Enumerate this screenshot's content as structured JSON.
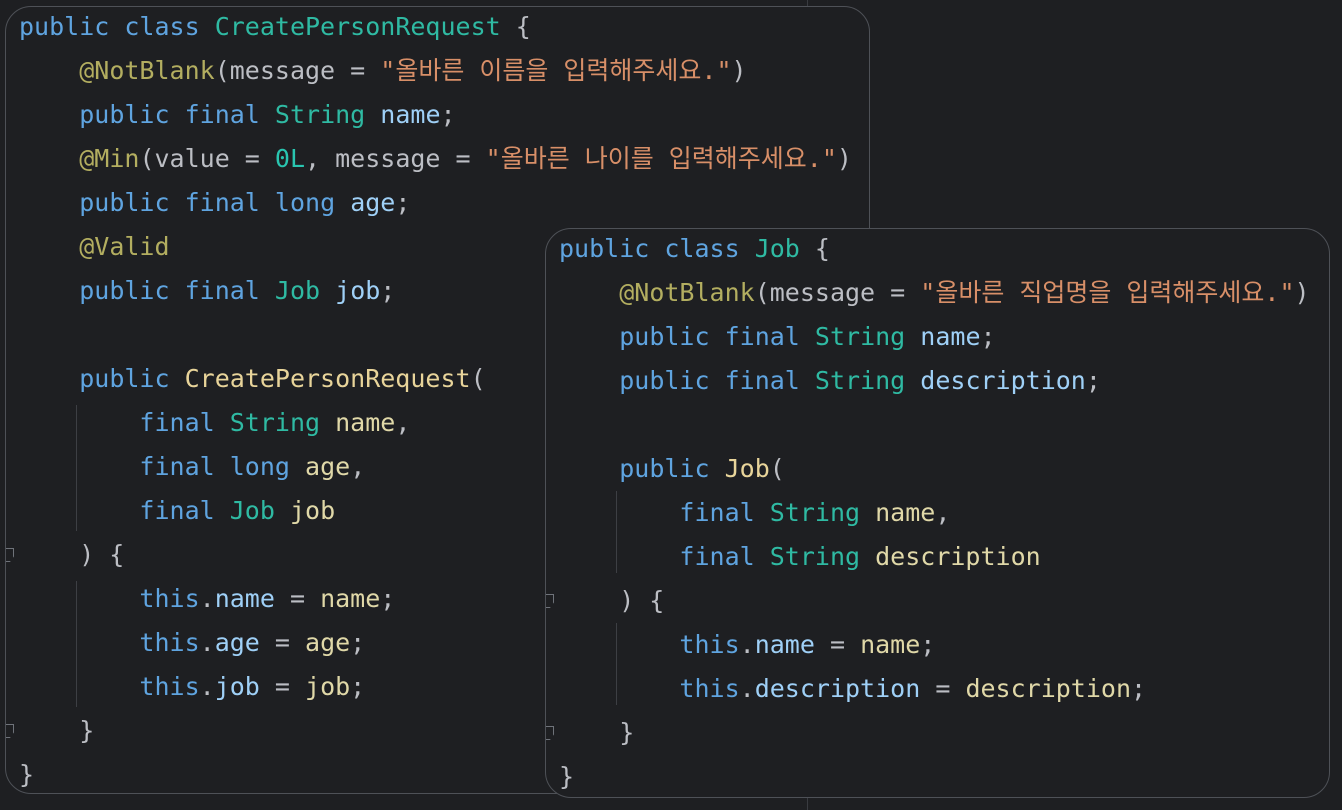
{
  "colors": {
    "background": "#1e1f22",
    "keyword": "#5fa4e0",
    "type": "#2fbaa3",
    "annotation": "#b3ae60",
    "field": "#9fd0f7",
    "function": "#e8d49a",
    "string": "#d88f68",
    "number": "#29c5b0",
    "parameter": "#e0d8a8",
    "plain": "#bcbec4"
  },
  "icons": {
    "fold_marker": "fold-marker-icon"
  },
  "left_snippet": {
    "lines": [
      [
        [
          "kw",
          "public"
        ],
        [
          "pl",
          " "
        ],
        [
          "kw",
          "class"
        ],
        [
          "pl",
          " "
        ],
        [
          "ty",
          "CreatePersonRequest"
        ],
        [
          "pl",
          " {"
        ]
      ],
      [
        [
          "pl",
          "    "
        ],
        [
          "ann",
          "@NotBlank"
        ],
        [
          "pl",
          "(message = "
        ],
        [
          "str",
          "\"올바른 이름을 입력해주세요.\""
        ],
        [
          "pl",
          ")"
        ]
      ],
      [
        [
          "pl",
          "    "
        ],
        [
          "kw",
          "public"
        ],
        [
          "pl",
          " "
        ],
        [
          "kw",
          "final"
        ],
        [
          "pl",
          " "
        ],
        [
          "ty",
          "String"
        ],
        [
          "pl",
          " "
        ],
        [
          "fld",
          "name"
        ],
        [
          "pl",
          ";"
        ]
      ],
      [
        [
          "pl",
          "    "
        ],
        [
          "ann",
          "@Min"
        ],
        [
          "pl",
          "(value = "
        ],
        [
          "num",
          "0L"
        ],
        [
          "pl",
          ", message = "
        ],
        [
          "str",
          "\"올바른 나이를 입력해주세요.\""
        ],
        [
          "pl",
          ")"
        ]
      ],
      [
        [
          "pl",
          "    "
        ],
        [
          "kw",
          "public"
        ],
        [
          "pl",
          " "
        ],
        [
          "kw",
          "final"
        ],
        [
          "pl",
          " "
        ],
        [
          "kw",
          "long"
        ],
        [
          "pl",
          " "
        ],
        [
          "fld",
          "age"
        ],
        [
          "pl",
          ";"
        ]
      ],
      [
        [
          "pl",
          "    "
        ],
        [
          "ann",
          "@Valid"
        ]
      ],
      [
        [
          "pl",
          "    "
        ],
        [
          "kw",
          "public"
        ],
        [
          "pl",
          " "
        ],
        [
          "kw",
          "final"
        ],
        [
          "pl",
          " "
        ],
        [
          "ty",
          "Job"
        ],
        [
          "pl",
          " "
        ],
        [
          "fld",
          "job"
        ],
        [
          "pl",
          ";"
        ]
      ],
      [
        [
          "pl",
          ""
        ]
      ],
      [
        [
          "pl",
          "    "
        ],
        [
          "kw",
          "public"
        ],
        [
          "pl",
          " "
        ],
        [
          "fn",
          "CreatePersonRequest"
        ],
        [
          "pl",
          "("
        ]
      ],
      [
        [
          "pl",
          "        "
        ],
        [
          "kw",
          "final"
        ],
        [
          "pl",
          " "
        ],
        [
          "ty",
          "String"
        ],
        [
          "pl",
          " "
        ],
        [
          "par",
          "name"
        ],
        [
          "pl",
          ","
        ]
      ],
      [
        [
          "pl",
          "        "
        ],
        [
          "kw",
          "final"
        ],
        [
          "pl",
          " "
        ],
        [
          "kw",
          "long"
        ],
        [
          "pl",
          " "
        ],
        [
          "par",
          "age"
        ],
        [
          "pl",
          ","
        ]
      ],
      [
        [
          "pl",
          "        "
        ],
        [
          "kw",
          "final"
        ],
        [
          "pl",
          " "
        ],
        [
          "ty",
          "Job"
        ],
        [
          "pl",
          " "
        ],
        [
          "par",
          "job"
        ]
      ],
      [
        [
          "pl",
          "    ) {"
        ]
      ],
      [
        [
          "pl",
          "        "
        ],
        [
          "kw",
          "this"
        ],
        [
          "pl",
          "."
        ],
        [
          "fld",
          "name"
        ],
        [
          "pl",
          " = "
        ],
        [
          "par",
          "name"
        ],
        [
          "pl",
          ";"
        ]
      ],
      [
        [
          "pl",
          "        "
        ],
        [
          "kw",
          "this"
        ],
        [
          "pl",
          "."
        ],
        [
          "fld",
          "age"
        ],
        [
          "pl",
          " = "
        ],
        [
          "par",
          "age"
        ],
        [
          "pl",
          ";"
        ]
      ],
      [
        [
          "pl",
          "        "
        ],
        [
          "kw",
          "this"
        ],
        [
          "pl",
          "."
        ],
        [
          "fld",
          "job"
        ],
        [
          "pl",
          " = "
        ],
        [
          "par",
          "job"
        ],
        [
          "pl",
          ";"
        ]
      ],
      [
        [
          "pl",
          "    }"
        ]
      ],
      [
        [
          "pl",
          "}"
        ]
      ]
    ]
  },
  "right_snippet": {
    "lines": [
      [
        [
          "kw",
          "public"
        ],
        [
          "pl",
          " "
        ],
        [
          "kw",
          "class"
        ],
        [
          "pl",
          " "
        ],
        [
          "ty",
          "Job"
        ],
        [
          "pl",
          " {"
        ]
      ],
      [
        [
          "pl",
          "    "
        ],
        [
          "ann",
          "@NotBlank"
        ],
        [
          "pl",
          "(message = "
        ],
        [
          "str",
          "\"올바른 직업명을 입력해주세요.\""
        ],
        [
          "pl",
          ")"
        ]
      ],
      [
        [
          "pl",
          "    "
        ],
        [
          "kw",
          "public"
        ],
        [
          "pl",
          " "
        ],
        [
          "kw",
          "final"
        ],
        [
          "pl",
          " "
        ],
        [
          "ty",
          "String"
        ],
        [
          "pl",
          " "
        ],
        [
          "fld",
          "name"
        ],
        [
          "pl",
          ";"
        ]
      ],
      [
        [
          "pl",
          "    "
        ],
        [
          "kw",
          "public"
        ],
        [
          "pl",
          " "
        ],
        [
          "kw",
          "final"
        ],
        [
          "pl",
          " "
        ],
        [
          "ty",
          "String"
        ],
        [
          "pl",
          " "
        ],
        [
          "fld",
          "description"
        ],
        [
          "pl",
          ";"
        ]
      ],
      [
        [
          "pl",
          ""
        ]
      ],
      [
        [
          "pl",
          "    "
        ],
        [
          "kw",
          "public"
        ],
        [
          "pl",
          " "
        ],
        [
          "fn",
          "Job"
        ],
        [
          "pl",
          "("
        ]
      ],
      [
        [
          "pl",
          "        "
        ],
        [
          "kw",
          "final"
        ],
        [
          "pl",
          " "
        ],
        [
          "ty",
          "String"
        ],
        [
          "pl",
          " "
        ],
        [
          "par",
          "name"
        ],
        [
          "pl",
          ","
        ]
      ],
      [
        [
          "pl",
          "        "
        ],
        [
          "kw",
          "final"
        ],
        [
          "pl",
          " "
        ],
        [
          "ty",
          "String"
        ],
        [
          "pl",
          " "
        ],
        [
          "par",
          "description"
        ]
      ],
      [
        [
          "pl",
          "    ) {"
        ]
      ],
      [
        [
          "pl",
          "        "
        ],
        [
          "kw",
          "this"
        ],
        [
          "pl",
          "."
        ],
        [
          "fld",
          "name"
        ],
        [
          "pl",
          " = "
        ],
        [
          "par",
          "name"
        ],
        [
          "pl",
          ";"
        ]
      ],
      [
        [
          "pl",
          "        "
        ],
        [
          "kw",
          "this"
        ],
        [
          "pl",
          "."
        ],
        [
          "fld",
          "description"
        ],
        [
          "pl",
          " = "
        ],
        [
          "par",
          "description"
        ],
        [
          "pl",
          ";"
        ]
      ],
      [
        [
          "pl",
          "    }"
        ]
      ],
      [
        [
          "pl",
          "}"
        ]
      ]
    ]
  }
}
